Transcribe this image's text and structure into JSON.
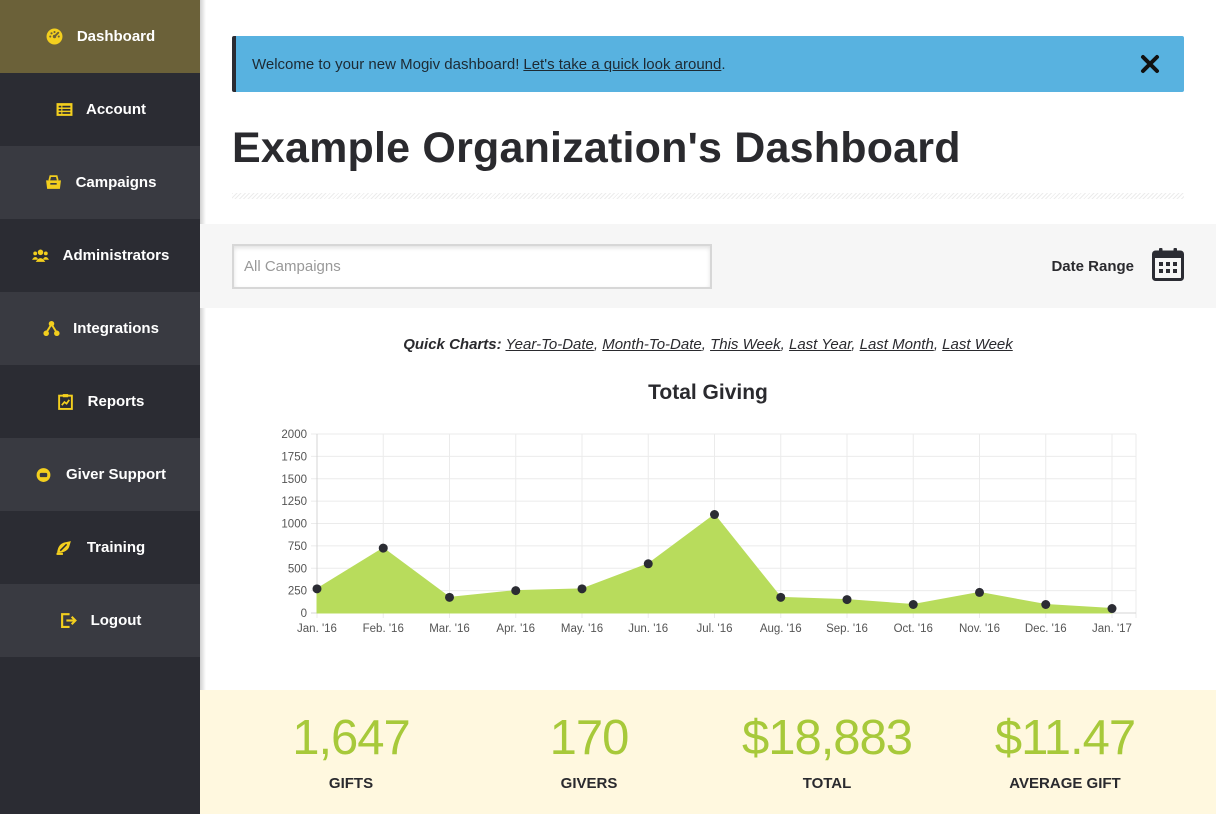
{
  "sidebar": {
    "items": [
      {
        "label": "Dashboard",
        "icon": "dashboard-icon"
      },
      {
        "label": "Account",
        "icon": "account-icon"
      },
      {
        "label": "Campaigns",
        "icon": "campaigns-icon"
      },
      {
        "label": "Administrators",
        "icon": "administrators-icon"
      },
      {
        "label": "Integrations",
        "icon": "integrations-icon"
      },
      {
        "label": "Reports",
        "icon": "reports-icon"
      },
      {
        "label": "Giver Support",
        "icon": "giver-support-icon"
      },
      {
        "label": "Training",
        "icon": "training-icon"
      },
      {
        "label": "Logout",
        "icon": "logout-icon"
      }
    ],
    "active": "Dashboard",
    "icon_color": "#f3cf1e"
  },
  "banner": {
    "text": "Welcome to your new Mogiv dashboard!",
    "link": "Let's take a quick look around",
    "suffix": ".",
    "close_icon": "close-icon",
    "color": "#58b2e0"
  },
  "page": {
    "title": "Example Organization's Dashboard"
  },
  "filters": {
    "campaign_placeholder": "All Campaigns",
    "date_range_label": "Date Range",
    "date_range_icon": "calendar-icon"
  },
  "quick_charts": {
    "label": "Quick Charts:",
    "links": [
      "Year-To-Date",
      "Month-To-Date",
      "This Week",
      "Last Year",
      "Last Month",
      "Last Week"
    ]
  },
  "chart_data": {
    "type": "area",
    "title": "Total Giving",
    "categories": [
      "Jan. '16",
      "Feb. '16",
      "Mar. '16",
      "Apr. '16",
      "May. '16",
      "Jun. '16",
      "Jul. '16",
      "Aug. '16",
      "Sep. '16",
      "Oct. '16",
      "Nov. '16",
      "Dec. '16",
      "Jan. '17"
    ],
    "values": [
      270,
      725,
      175,
      250,
      270,
      550,
      1100,
      175,
      150,
      95,
      230,
      95,
      50
    ],
    "y_ticks": [
      0,
      250,
      500,
      750,
      1000,
      1250,
      1500,
      1750,
      2000
    ],
    "ylim": [
      0,
      2000
    ],
    "grid": true,
    "fill_color": "#b8dc5c",
    "point_color": "#2b2c33"
  },
  "stats": [
    {
      "value": "1,647",
      "label": "GIFTS"
    },
    {
      "value": "170",
      "label": "GIVERS"
    },
    {
      "value": "$18,883",
      "label": "TOTAL"
    },
    {
      "value": "$11.47",
      "label": "AVERAGE GIFT"
    }
  ],
  "colors": {
    "stat_value": "#a7c93a",
    "stats_background": "#fff8df",
    "sidebar_active": "#6b6139"
  }
}
